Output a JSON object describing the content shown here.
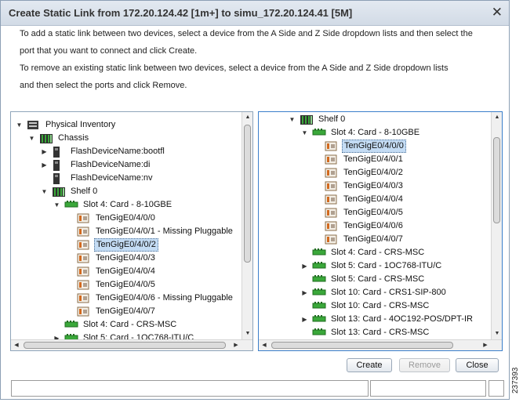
{
  "dialog": {
    "title": "Create Static Link from 172.20.124.42 [1m+] to simu_172.20.124.41 [5M]",
    "instructions": [
      "To add a static link between two devices, select a device from the A Side and Z Side dropdown lists and then select the",
      "port that you want to connect and click Create.",
      "To remove an existing static link between two devices, select a device from the A Side and Z Side dropdown lists",
      "and then select the ports and click Remove."
    ],
    "buttons": {
      "create": "Create",
      "remove": "Remove",
      "close": "Close"
    },
    "side_id": "237393"
  },
  "left_tree": [
    {
      "label": "Physical Inventory",
      "level": 0,
      "toggle": "expanded",
      "icon": "inventory-icon"
    },
    {
      "label": "Chassis",
      "level": 1,
      "toggle": "expanded",
      "icon": "chassis-icon"
    },
    {
      "label": "FlashDeviceName:bootfl",
      "level": 2,
      "toggle": "collapsed",
      "icon": "flash-device-icon"
    },
    {
      "label": "FlashDeviceName:di",
      "level": 2,
      "toggle": "collapsed",
      "icon": "flash-device-icon"
    },
    {
      "label": "FlashDeviceName:nv",
      "level": 2,
      "toggle": "none",
      "icon": "flash-device-icon"
    },
    {
      "label": "Shelf 0",
      "level": 2,
      "toggle": "expanded",
      "icon": "shelf-icon"
    },
    {
      "label": "Slot 4: Card - 8-10GBE",
      "level": 3,
      "toggle": "expanded",
      "icon": "card-icon"
    },
    {
      "label": "TenGigE0/4/0/0",
      "level": 4,
      "toggle": "none",
      "icon": "port-icon"
    },
    {
      "label": "TenGigE0/4/0/1 - Missing Pluggable",
      "level": 4,
      "toggle": "none",
      "icon": "port-icon"
    },
    {
      "label": "TenGigE0/4/0/2",
      "level": 4,
      "toggle": "none",
      "icon": "port-icon",
      "selected": true
    },
    {
      "label": "TenGigE0/4/0/3",
      "level": 4,
      "toggle": "none",
      "icon": "port-icon"
    },
    {
      "label": "TenGigE0/4/0/4",
      "level": 4,
      "toggle": "none",
      "icon": "port-icon"
    },
    {
      "label": "TenGigE0/4/0/5",
      "level": 4,
      "toggle": "none",
      "icon": "port-icon"
    },
    {
      "label": "TenGigE0/4/0/6 - Missing Pluggable",
      "level": 4,
      "toggle": "none",
      "icon": "port-icon"
    },
    {
      "label": "TenGigE0/4/0/7",
      "level": 4,
      "toggle": "none",
      "icon": "port-icon"
    },
    {
      "label": "Slot 4: Card - CRS-MSC",
      "level": 3,
      "toggle": "none",
      "icon": "card-icon"
    },
    {
      "label": "Slot 5: Card - 1OC768-ITU/C",
      "level": 3,
      "toggle": "collapsed",
      "icon": "card-icon"
    }
  ],
  "right_tree": [
    {
      "label": "Shelf 0",
      "level": 0,
      "toggle": "expanded",
      "icon": "shelf-icon"
    },
    {
      "label": "Slot 4: Card - 8-10GBE",
      "level": 1,
      "toggle": "expanded",
      "icon": "card-icon"
    },
    {
      "label": "TenGigE0/4/0/0",
      "level": 2,
      "toggle": "none",
      "icon": "port-icon",
      "selected": true
    },
    {
      "label": "TenGigE0/4/0/1",
      "level": 2,
      "toggle": "none",
      "icon": "port-icon"
    },
    {
      "label": "TenGigE0/4/0/2",
      "level": 2,
      "toggle": "none",
      "icon": "port-icon"
    },
    {
      "label": "TenGigE0/4/0/3",
      "level": 2,
      "toggle": "none",
      "icon": "port-icon"
    },
    {
      "label": "TenGigE0/4/0/4",
      "level": 2,
      "toggle": "none",
      "icon": "port-icon"
    },
    {
      "label": "TenGigE0/4/0/5",
      "level": 2,
      "toggle": "none",
      "icon": "port-icon"
    },
    {
      "label": "TenGigE0/4/0/6",
      "level": 2,
      "toggle": "none",
      "icon": "port-icon"
    },
    {
      "label": "TenGigE0/4/0/7",
      "level": 2,
      "toggle": "none",
      "icon": "port-icon"
    },
    {
      "label": "Slot 4: Card - CRS-MSC",
      "level": 1,
      "toggle": "none",
      "icon": "card-icon"
    },
    {
      "label": "Slot 5: Card - 1OC768-ITU/C",
      "level": 1,
      "toggle": "collapsed",
      "icon": "card-icon"
    },
    {
      "label": "Slot 5: Card - CRS-MSC",
      "level": 1,
      "toggle": "none",
      "icon": "card-icon"
    },
    {
      "label": "Slot 10: Card - CRS1-SIP-800",
      "level": 1,
      "toggle": "collapsed",
      "icon": "card-icon"
    },
    {
      "label": "Slot 10: Card - CRS-MSC",
      "level": 1,
      "toggle": "none",
      "icon": "card-icon"
    },
    {
      "label": "Slot 13: Card - 4OC192-POS/DPT-IR",
      "level": 1,
      "toggle": "collapsed",
      "icon": "card-icon"
    },
    {
      "label": "Slot 13: Card - CRS-MSC",
      "level": 1,
      "toggle": "none",
      "icon": "card-icon"
    }
  ],
  "colors": {
    "selection": "#c4dcf4",
    "card_green": "#3aa83a",
    "port_orange": "#d2691e",
    "active_border": "#3b7fcb"
  }
}
